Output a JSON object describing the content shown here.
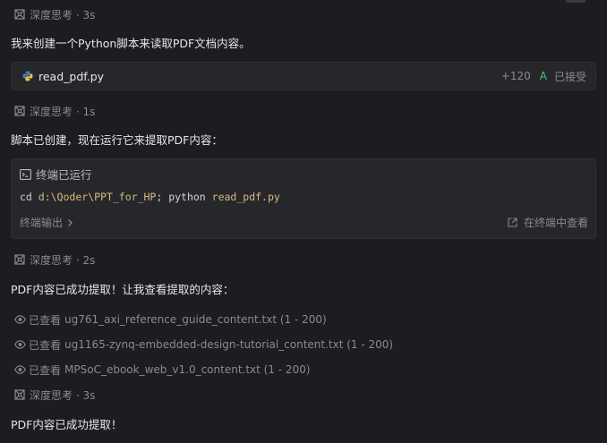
{
  "thinking": [
    {
      "label": "深度思考 · 3s"
    },
    {
      "label": "深度思考 · 1s"
    },
    {
      "label": "深度思考 · 2s"
    },
    {
      "label": "深度思考 · 3s"
    }
  ],
  "messages": [
    {
      "text": "我来创建一个Python脚本来读取PDF文档内容。"
    },
    {
      "text": "脚本已创建，现在运行它来提取PDF内容："
    },
    {
      "text": "PDF内容已成功提取！让我查看提取的内容："
    },
    {
      "text": "PDF内容已成功提取！"
    }
  ],
  "file_card": {
    "filename": "read_pdf.py",
    "added_lines": "+120",
    "status_letter": "A",
    "accepted_label": "已接受",
    "colors": {
      "status": "#4ec26a",
      "python_blue": "#4a7fc1",
      "python_yellow": "#f2c744"
    }
  },
  "terminal": {
    "title": "终端已运行",
    "cmd_prefix": "cd ",
    "cmd_path": "d:\\Qoder\\PPT_for_HP",
    "cmd_sep": "; python ",
    "cmd_arg": "read_pdf.py",
    "output_label": "终端输出",
    "view_in_terminal": "在终端中查看",
    "colors": {
      "path": "#d7ba7d"
    }
  },
  "viewed_files": [
    {
      "prefix": "已查看",
      "file": "ug761_axi_reference_guide_content.txt (1 - 200)"
    },
    {
      "prefix": "已查看",
      "file": "ug1165-zynq-embedded-design-tutorial_content.txt (1 - 200)"
    },
    {
      "prefix": "已查看",
      "file": "MPSoC_ebook_web_v1.0_content.txt (1 - 200)"
    }
  ],
  "icons": {
    "thinking": "thinking-icon",
    "python": "python-file-icon",
    "terminal": "terminal-icon",
    "chevron": "chevron-right-icon",
    "open_external": "open-external-icon",
    "eye": "eye-icon"
  }
}
